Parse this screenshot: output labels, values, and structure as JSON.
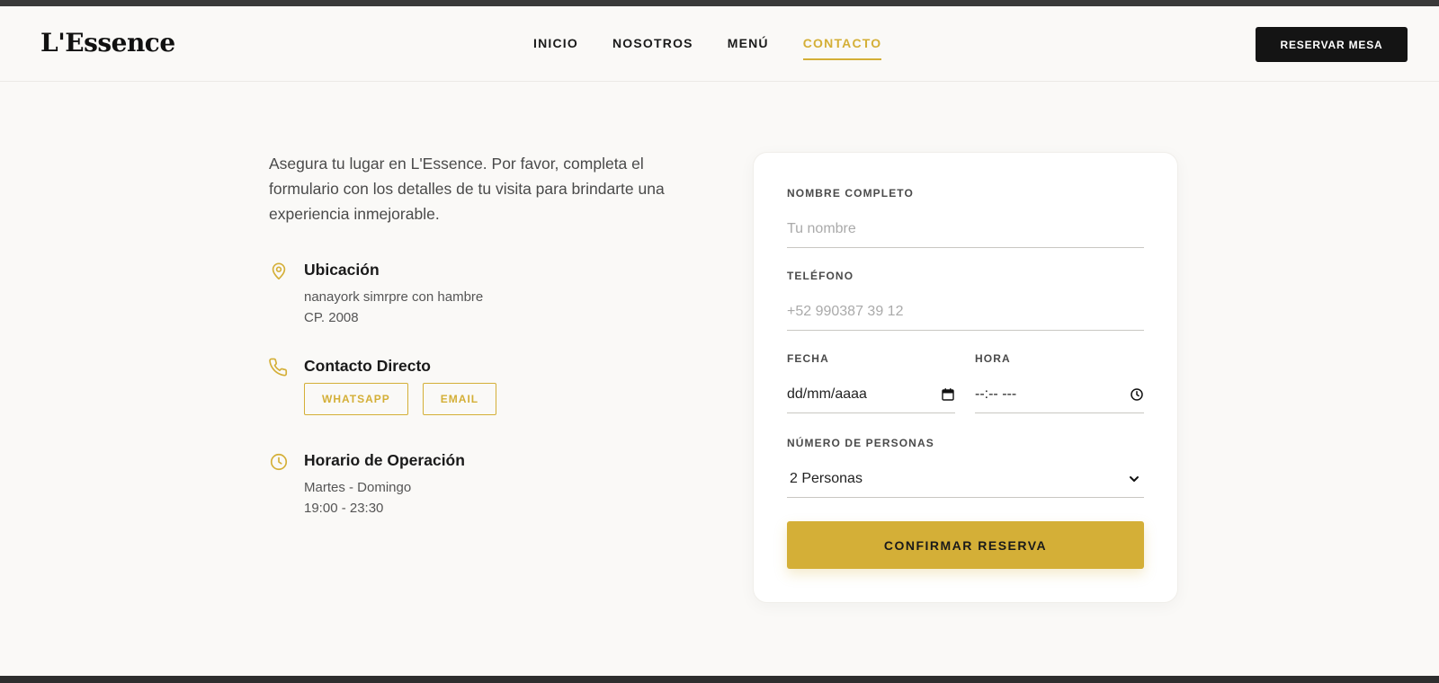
{
  "brand": {
    "logo": "L'Essence"
  },
  "nav": {
    "items": [
      {
        "label": "INICIO"
      },
      {
        "label": "NOSOTROS"
      },
      {
        "label": "MENÚ"
      },
      {
        "label": "CONTACTO",
        "active": true
      }
    ],
    "cta_label": "RESERVAR MESA"
  },
  "intro": {
    "text": "Asegura tu lugar en L'Essence. Por favor, completa el formulario con los detalles de tu visita para brindarte una experiencia inmejorable."
  },
  "info": {
    "location": {
      "title": "Ubicación",
      "line1": "nanayork simrpre con hambre",
      "line2": "CP. 2008",
      "icon": "map-pin-icon"
    },
    "contact": {
      "title": "Contacto Directo",
      "whatsapp_label": "WHATSAPP",
      "email_label": "EMAIL",
      "icon": "phone-icon"
    },
    "hours": {
      "title": "Horario de Operación",
      "line1": "Martes - Domingo",
      "line2": "19:00 - 23:30",
      "icon": "clock-icon"
    }
  },
  "form": {
    "name": {
      "label": "NOMBRE COMPLETO",
      "placeholder": "Tu nombre",
      "value": ""
    },
    "phone": {
      "label": "TELÉFONO",
      "placeholder": "+52 990387 39 12",
      "value": ""
    },
    "date": {
      "label": "FECHA",
      "display": "dd/mm/aaaa",
      "icon": "calendar-icon"
    },
    "time": {
      "label": "HORA",
      "display": "--:-- ---",
      "icon": "clock-icon"
    },
    "guests": {
      "label": "NÚMERO DE PERSONAS",
      "selected": "2 Personas",
      "icon": "chevron-down-icon"
    },
    "submit_label": "CONFIRMAR RESERVA"
  },
  "colors": {
    "accent": "#d4af37",
    "dark": "#141414",
    "background": "#faf9f7"
  }
}
